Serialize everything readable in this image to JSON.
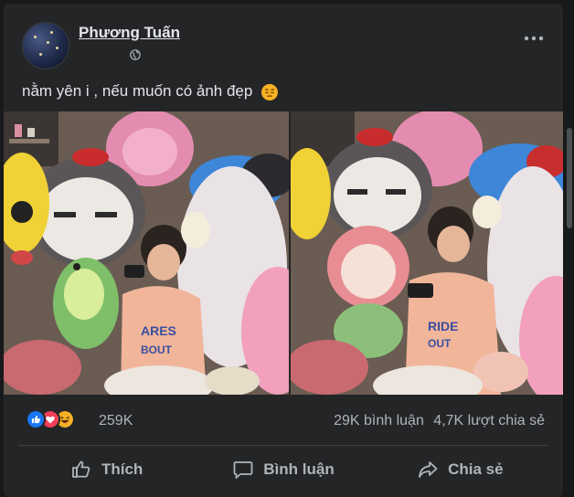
{
  "post": {
    "author": "Phương Tuấn",
    "privacy_icon": "globe-icon",
    "text": "nằm yên i , nếu muốn có ảnh đẹp",
    "text_emoji": "pensive-face-emoji"
  },
  "photos": [
    {
      "name": "photo-left"
    },
    {
      "name": "photo-right"
    }
  ],
  "stats": {
    "reactions": [
      "like",
      "love",
      "haha"
    ],
    "reaction_count": "259K",
    "comments": "29K bình luận",
    "shares": "4,7K lượt chia sẻ"
  },
  "actions": {
    "like": "Thích",
    "comment": "Bình luận",
    "share": "Chia sẻ"
  },
  "colors": {
    "background": "#242526",
    "text_primary": "#e4e6eb",
    "text_secondary": "#b0b3b8",
    "like_blue": "#1877f2",
    "love_red": "#f33e58",
    "haha_yellow": "#f7b125"
  }
}
